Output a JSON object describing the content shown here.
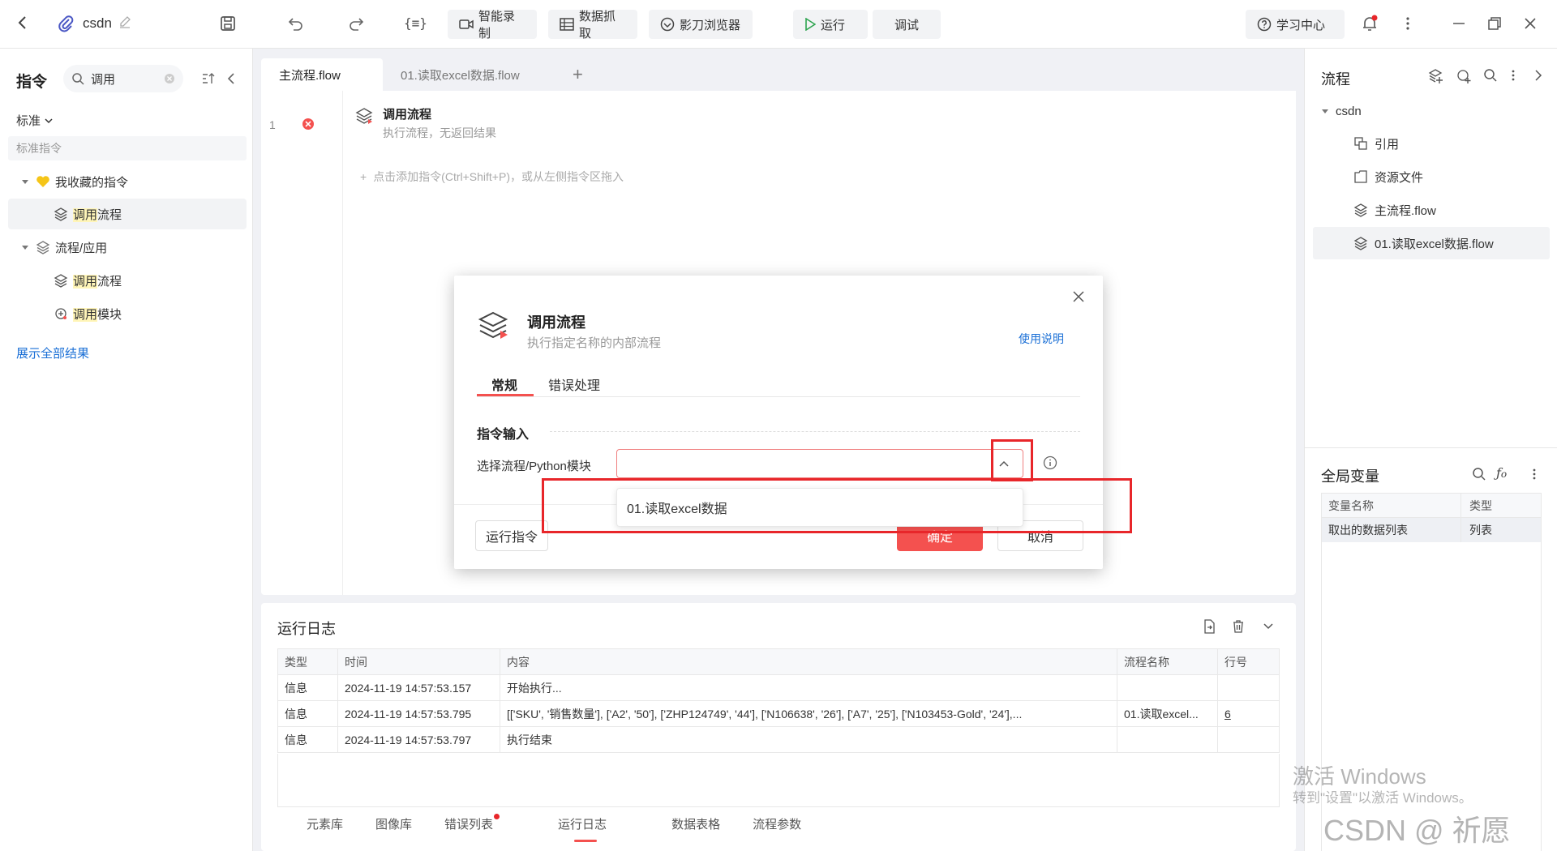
{
  "topbar": {
    "project_name": "csdn",
    "buttons": {
      "smart_record": "智能录制",
      "data_capture": "数据抓取",
      "shadow_browser": "影刀浏览器",
      "run": "运行",
      "debug": "调试",
      "learning_center": "学习中心"
    },
    "bracket_icon": "{≡}"
  },
  "left": {
    "title": "指令",
    "search_value": "调用",
    "filter_label": "标准",
    "section_header": "标准指令",
    "groups": [
      {
        "label": "我收藏的指令",
        "items": [
          {
            "prefix": "",
            "hl": "调用",
            "rest": "流程"
          }
        ]
      },
      {
        "label": "流程/应用",
        "items": [
          {
            "hl": "调用",
            "rest": "流程"
          },
          {
            "hl": "调用",
            "rest": "模块"
          }
        ]
      }
    ],
    "show_all": "展示全部结果"
  },
  "editor": {
    "tabs": [
      "主流程.flow",
      "01.读取excel数据.flow"
    ],
    "add_tab": "+",
    "line_number": "1",
    "step_title": "调用流程",
    "step_desc": "执行流程，无返回结果",
    "add_hint": "点击添加指令(Ctrl+Shift+P)，或从左侧指令区拖入"
  },
  "dialog": {
    "title": "调用流程",
    "subtitle": "执行指定名称的内部流程",
    "help_link": "使用说明",
    "tabs": [
      "常规",
      "错误处理"
    ],
    "section": "指令输入",
    "field_label": "选择流程/Python模块",
    "select_value": "",
    "dropdown_option": "01.读取excel数据",
    "run_button": "运行指令",
    "ok_button": "确定",
    "cancel_button": "取消"
  },
  "log": {
    "title": "运行日志",
    "columns": [
      "类型",
      "时间",
      "内容",
      "流程名称",
      "行号"
    ],
    "rows": [
      [
        "信息",
        "2024-11-19 14:57:53.157",
        "开始执行...",
        "",
        ""
      ],
      [
        "信息",
        "2024-11-19 14:57:53.795",
        "[['SKU', '销售数量'], ['A2', '50'], ['ZHP124749', '44'], ['N106638', '26'], ['A7', '25'], ['N103453-Gold', '24'],...",
        "01.读取excel...",
        "6"
      ],
      [
        "信息",
        "2024-11-19 14:57:53.797",
        "执行结束",
        "",
        ""
      ]
    ],
    "bottom_tabs": [
      "元素库",
      "图像库",
      "错误列表",
      "运行日志",
      "数据表格",
      "流程参数"
    ]
  },
  "right": {
    "title": "流程",
    "tree_root": "csdn",
    "tree_items": [
      "引用",
      "资源文件",
      "主流程.flow",
      "01.读取excel数据.flow"
    ],
    "globals_title": "全局变量",
    "globals_columns": [
      "变量名称",
      "类型"
    ],
    "globals_rows": [
      [
        "取出的数据列表",
        "列表"
      ]
    ]
  },
  "watermarks": {
    "activate_line1": "激活 Windows",
    "activate_line2": "转到\"设置\"以激活 Windows。",
    "csdn": "CSDN @ 祈愿"
  },
  "colors": {
    "accent_red": "#f4514f",
    "link_blue": "#1a6fd6",
    "highlight_box": "#e8262a"
  }
}
